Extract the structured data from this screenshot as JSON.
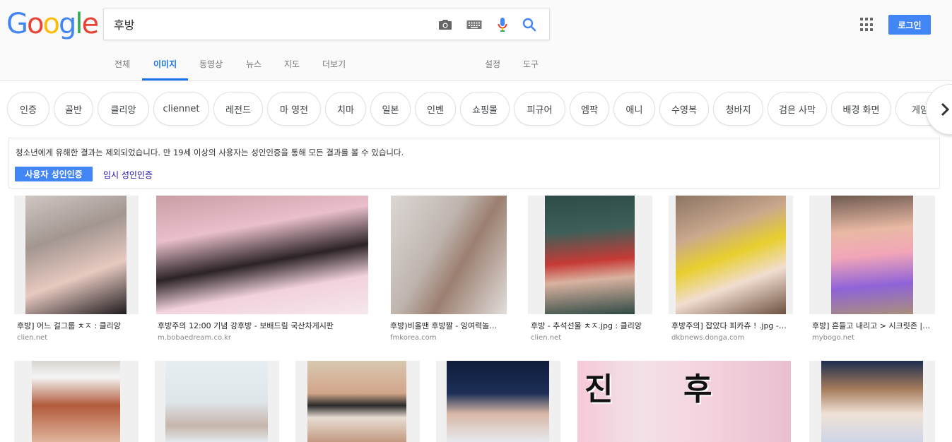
{
  "logo": {
    "letters": [
      "G",
      "o",
      "o",
      "g",
      "l",
      "e"
    ]
  },
  "search": {
    "query": "후방"
  },
  "header": {
    "login_label": "로그인"
  },
  "tabs": [
    {
      "label": "전체"
    },
    {
      "label": "이미지"
    },
    {
      "label": "동영상"
    },
    {
      "label": "뉴스"
    },
    {
      "label": "지도"
    },
    {
      "label": "더보기"
    },
    {
      "label": "설정"
    },
    {
      "label": "도구"
    }
  ],
  "chips": [
    {
      "label": "인증"
    },
    {
      "label": "골반"
    },
    {
      "label": "클리앙"
    },
    {
      "label": "cliennet"
    },
    {
      "label": "레전드"
    },
    {
      "label": "마 영전"
    },
    {
      "label": "치마"
    },
    {
      "label": "일본"
    },
    {
      "label": "인벤"
    },
    {
      "label": "쇼핑몰"
    },
    {
      "label": "피규어"
    },
    {
      "label": "엠팍"
    },
    {
      "label": "애니"
    },
    {
      "label": "수영복"
    },
    {
      "label": "청바지"
    },
    {
      "label": "검은 사막"
    },
    {
      "label": "배경 화면"
    },
    {
      "label": "게임"
    }
  ],
  "notice": {
    "text": "청소년에게 유해한 결과는 제외되었습니다. 만 19세 이상의 사용자는 성인인증을 통해 모든 결과를 볼 수 있습니다.",
    "verify_label": "사용자 성인인증",
    "temp_label": "임시 성인인증"
  },
  "results": [
    {
      "caption": "후방] 어느 걸그룹 ㅊㅈ : 클리앙",
      "source": "clien.net"
    },
    {
      "caption": "후방주의 12:00 기념 강후방 - 보배드림 국산차게시판",
      "source": "m.bobaedream.co.kr"
    },
    {
      "caption": "후방)비올땐 후방짤 - 잉여력놀…",
      "source": "fmkorea.com"
    },
    {
      "caption": "후방 - 추석선물 ㅊㅈ.jpg : 클리앙",
      "source": "clien.net"
    },
    {
      "caption": "후방주의] 잡았다 피카츄 ! .jpg -…",
      "source": "dkbnews.donga.com"
    },
    {
      "caption": "후방] 흔들고 내리고 > 시크릿존 |…",
      "source": "mybogo.net"
    }
  ],
  "row2_overlay": {
    "left_char": "진",
    "right_char": "후"
  }
}
